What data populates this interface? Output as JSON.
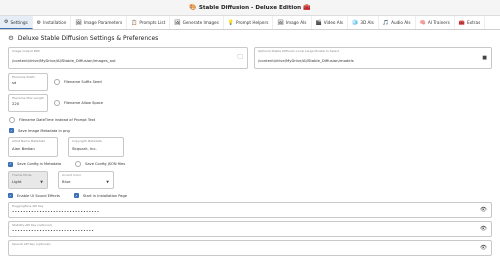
{
  "window": {
    "title": "Stable Diffusion - Deluxe Edition",
    "left_emoji": "🎨",
    "right_emoji": "🧰"
  },
  "tabs": [
    {
      "label": "Settings",
      "icon": "⚙"
    },
    {
      "label": "Installation",
      "icon": "⚙"
    },
    {
      "label": "Image Parameters",
      "icon": "🖼"
    },
    {
      "label": "Prompts List",
      "icon": "📋"
    },
    {
      "label": "Generate Images",
      "icon": "🖼"
    },
    {
      "label": "Prompt Helpers",
      "icon": "💡"
    },
    {
      "label": "Image AIs",
      "icon": "🖼"
    },
    {
      "label": "Video AIs",
      "icon": "🎬"
    },
    {
      "label": "3D AIs",
      "icon": "🧊"
    },
    {
      "label": "Audio AIs",
      "icon": "🎵"
    },
    {
      "label": "AI Trainers",
      "icon": "🧠"
    },
    {
      "label": "Extras",
      "icon": "🧰"
    }
  ],
  "section": {
    "title": "Deluxe Stable Diffusion Settings & Preferences"
  },
  "fields": {
    "image_output_path": {
      "label": "Image Output Path",
      "value": "/content/drive/MyDrive/AI/Stable_Diffusion/images_out"
    },
    "optional_models_path": {
      "label": "Optional Stable Diffusion Local Large Models to Select",
      "value": "/content/drive/MyDrive/AI/Stable_Diffusion/models"
    },
    "filename_prefix": {
      "label": "Filename Prefix",
      "value": "sd"
    },
    "filename_max_length": {
      "label": "Filename Max Length",
      "value": "220"
    },
    "artist_name": {
      "label": "Artist Name Metadata",
      "value": "Alan Bedian"
    },
    "copyright": {
      "label": "Copyright Metadata",
      "value": "Skquark, Inc."
    },
    "theme_mode": {
      "label": "Theme Mode",
      "value": "Light"
    },
    "accent_color": {
      "label": "Accent Color",
      "value": "Blue"
    },
    "huggingface_key": {
      "label": "HuggingFace API Key",
      "value": "••••••••••••••••••••••••••••••••"
    },
    "stability_key": {
      "label": "Stability-API Key (optional)",
      "value": "••••••••••••••••••••••••••••••"
    },
    "openai_key": {
      "label": "OpenAI API Key (optional)",
      "value": ""
    }
  },
  "checks": {
    "filename_suffix_seed": "Filename Suffix Seed",
    "filename_allow_space": "Filename Allow Space",
    "filename_datetime": "Filename DateTime instead of Prompt Text",
    "save_image_metadata": "Save Image Metadata in png",
    "save_config_metadata": "Save Config in Metadata",
    "save_config_json": "Save Config JSON files",
    "enable_ui_sound": "Enable UI Sound Effects",
    "start_installation": "Start in Installation Page"
  },
  "colors": {
    "accent": "#3b6fb6",
    "tab_active_bg": "#e6edf7",
    "select_bg": "#e8e8e8"
  }
}
